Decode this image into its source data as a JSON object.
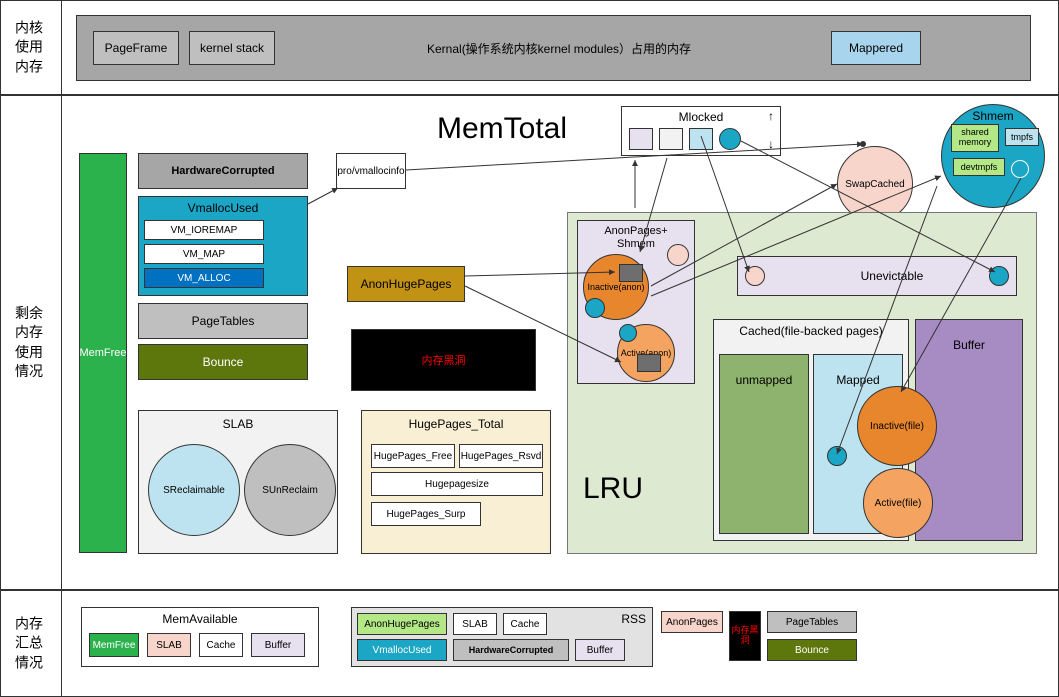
{
  "rows": {
    "r1": {
      "label": "内核\n使用\n内存",
      "kernel_caption": "Kernal(操作系统内核kernel modules）占用的内存"
    },
    "r2": {
      "label": "剩余\n内存\n使用\n情况"
    },
    "r3": {
      "label": "内存\n汇总\n情况"
    }
  },
  "top": {
    "pageframe": "PageFrame",
    "kernelstack": "kernel stack",
    "mappered": "Mappered"
  },
  "main": {
    "memtotal": "MemTotal",
    "memfree": "MemFree",
    "hwcorrupted": "HardwareCorrupted",
    "vmalloc_used": "VmallocUsed",
    "vm_ioremap": "VM_IOREMAP",
    "vm_map": "VM_MAP",
    "vm_alloc": "VM_ALLOC",
    "vmallocinfo": "pro/vmallocinfo",
    "pagetables": "PageTables",
    "bounce": "Bounce",
    "blackhole": "内存黑洞",
    "slab": "SLAB",
    "sreclaim": "SReclaimable",
    "sunreclaim": "SUnReclaim",
    "anon_huge": "AnonHugePages",
    "huge_total": "HugePages_Total",
    "huge_free": "HugePages_Free",
    "huge_rsvd": "HugePages_Rsvd",
    "hugepagesize": "Hugepagesize",
    "huge_surp": "HugePages_Surp",
    "mlocked": "Mlocked",
    "swapcached": "SwapCached",
    "shmem": "Shmem",
    "shared_memory": "shared memory",
    "tmpfs": "tmpfs",
    "devtmpfs": "devtmpfs",
    "anonpages_shmem": "AnonPages+\nShmem",
    "inactive_anon": "Inactive(anon)",
    "active_anon": "Active(anon)",
    "unevictable": "Unevictable",
    "cached": "Cached(file-backed pages)",
    "unmapped": "unmapped",
    "mapped": "Mapped",
    "buffer": "Buffer",
    "inactive_file": "Inactive(file)",
    "active_file": "Active(file)",
    "lru": "LRU"
  },
  "summary": {
    "memavailable": "MemAvailable",
    "memfree": "MemFree",
    "slab": "SLAB",
    "cache": "Cache",
    "buffer": "Buffer",
    "rss": "RSS",
    "anon_huge": "AnonHugePages",
    "vmalloc": "VmallocUsed",
    "hw": "HardwareCorrupted",
    "anonpages": "AnonPages",
    "pagetables": "PageTables",
    "bounce": "Bounce",
    "blackhole": "内存黑洞"
  },
  "colors": {
    "green": "#2BB24C",
    "darkgray": "#A6A6A6",
    "gray": "#BFBFBF",
    "teal": "#1AA6C4",
    "tealdark": "#0E8EA8",
    "blue": "#0070C0",
    "olive": "#5E770D",
    "mustard": "#C19213",
    "cream": "#F8EFD4",
    "black": "#000",
    "red": "#FF0000",
    "lavender": "#E6E0EF",
    "purple": "#B19CD9",
    "lightgreen": "#DDE9D0",
    "lightblue": "#BEE3F0",
    "skyblue": "#A8D4EE",
    "orange": "#F4A460",
    "darkorange": "#E8862E",
    "sage": "#8EB36F",
    "slate": "#6E6E6E",
    "pink": "#F8D5CB",
    "palegrn": "#b4e887",
    "violet": "#A78BC3"
  }
}
